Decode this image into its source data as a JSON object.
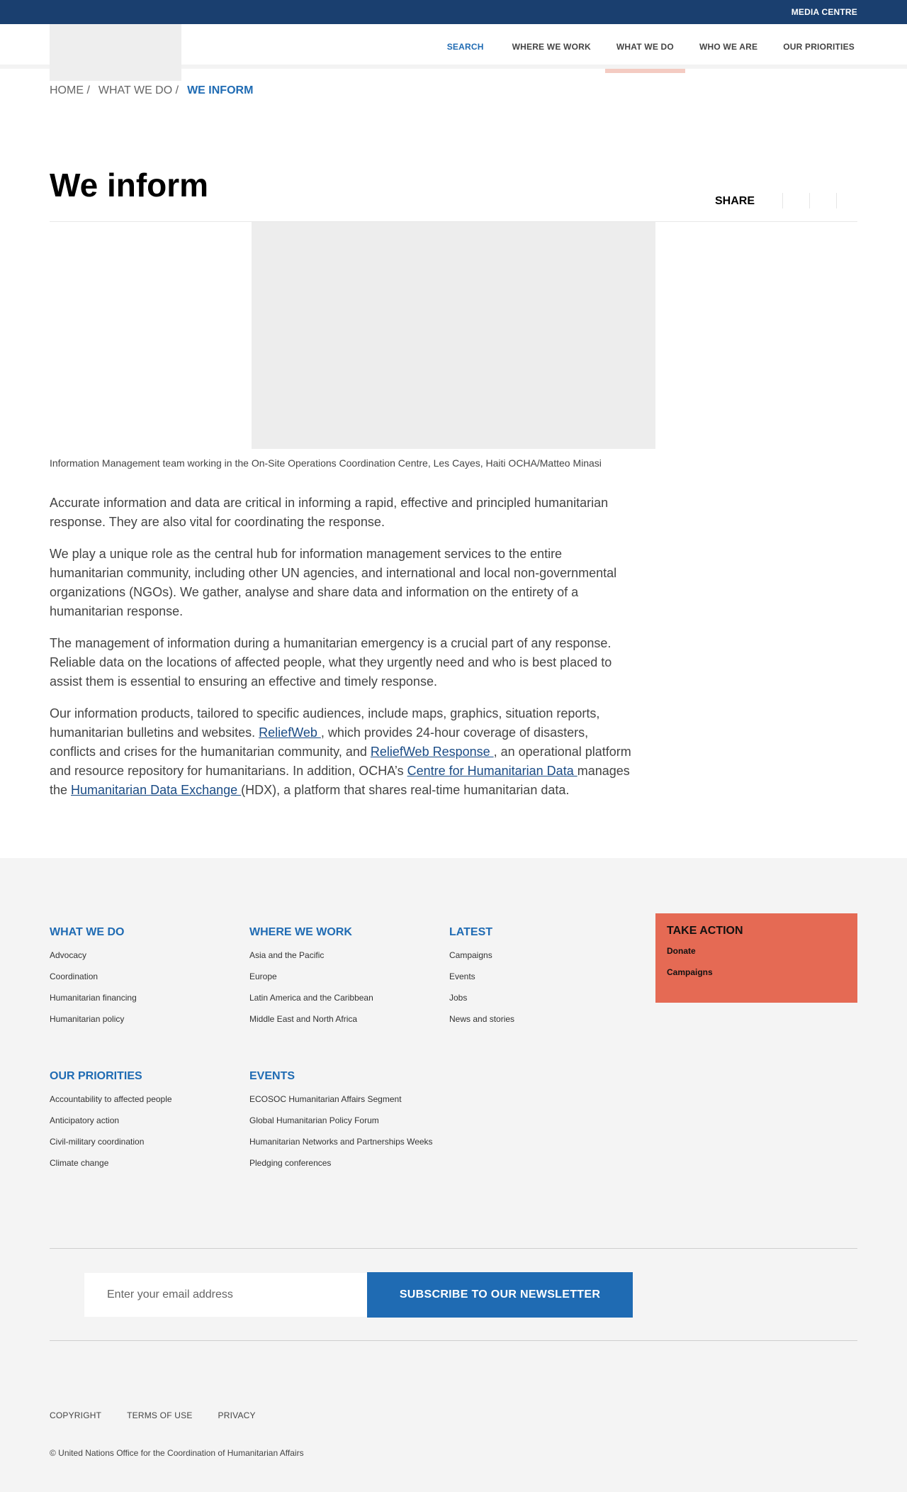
{
  "topbar": {
    "media_centre": "MEDIA CENTRE"
  },
  "nav": {
    "search": "SEARCH",
    "items": [
      "WHERE WE WORK",
      "WHAT WE DO",
      "WHO WE ARE",
      "OUR PRIORITIES"
    ],
    "active": "WHAT WE DO"
  },
  "breadcrumb": {
    "home": "HOME /",
    "what_we_do": "WHAT WE DO /",
    "current": "WE INFORM"
  },
  "page": {
    "title": "We inform",
    "share_label": "SHARE",
    "caption": "Information Management team working in the On-Site Operations Coordination Centre, Les Cayes, Haiti OCHA/Matteo Minasi"
  },
  "body": {
    "p1": "Accurate information and data are critical in informing a rapid, effective and principled humanitarian response. They are also vital for coordinating the response.",
    "p2": "We play a unique role as the central hub for information management services to the entire humanitarian community, including other UN agencies, and international and local non-governmental organizations (NGOs). We gather, analyse and share data and information on the entirety of a humanitarian response.",
    "p3": "The management of information during a humanitarian emergency is a crucial part of any response. Reliable data on the locations of affected people, what they urgently need and who is best placed to assist them is essential to ensuring an effective and timely response.",
    "p4_a": "Our information products, tailored to specific audiences, include maps, graphics, situation reports, humanitarian bulletins and websites. ",
    "p4_link1": "ReliefWeb ",
    "p4_b": ", which provides 24-hour coverage of disasters, conflicts and crises for the humanitarian community, and ",
    "p4_link2": "ReliefWeb Response ",
    "p4_c": ", an operational platform and resource repository for humanitarians. In addition, OCHA’s ",
    "p4_link3": "Centre for Humanitarian Data ",
    "p4_d": "manages the ",
    "p4_link4": "Humanitarian Data Exchange ",
    "p4_e": "(HDX), a platform that shares real-time humanitarian data."
  },
  "footer": {
    "what_we_do": {
      "title": "WHAT WE DO",
      "links": [
        "Advocacy",
        "Coordination",
        "Humanitarian financing",
        "Humanitarian policy"
      ]
    },
    "where_we_work": {
      "title": "WHERE WE WORK",
      "links": [
        "Asia and the Pacific",
        "Europe",
        "Latin America and the Caribbean",
        "Middle East and North Africa"
      ]
    },
    "latest": {
      "title": "LATEST",
      "links": [
        "Campaigns",
        "Events",
        "Jobs",
        "News and stories"
      ]
    },
    "take_action": {
      "title": "TAKE ACTION",
      "links": [
        "Donate",
        "Campaigns"
      ]
    },
    "our_priorities": {
      "title": "OUR PRIORITIES",
      "links": [
        "Accountability to affected people",
        "Anticipatory action",
        "Civil-military coordination",
        "Climate change"
      ]
    },
    "events": {
      "title": "EVENTS",
      "links": [
        "ECOSOC Humanitarian Affairs Segment",
        "Global Humanitarian Policy Forum",
        "Humanitarian Networks and Partnerships Weeks",
        "Pledging conferences"
      ]
    },
    "newsletter": {
      "placeholder": "Enter your email address",
      "button": "SUBSCRIBE TO OUR NEWSLETTER"
    },
    "legal": {
      "copyright": "COPYRIGHT",
      "terms": "TERMS OF USE",
      "privacy": "PRIVACY"
    },
    "copyright_text": "© United Nations Office for the Coordination of Humanitarian Affairs"
  }
}
